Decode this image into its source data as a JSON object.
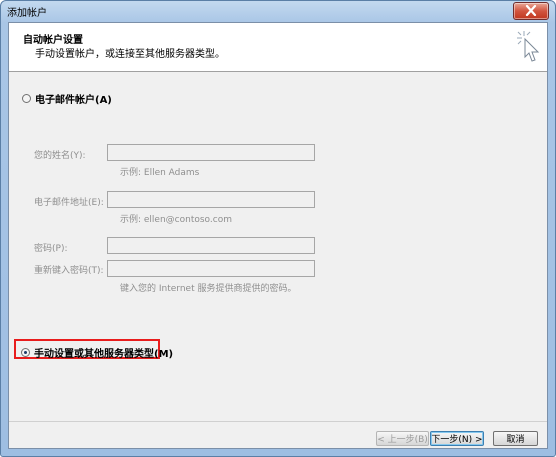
{
  "window": {
    "title": "添加帐户"
  },
  "header": {
    "title": "自动帐户设置",
    "subtitle": "手动设置帐户，或连接至其他服务器类型。"
  },
  "email_account": {
    "radio_label": "电子邮件帐户(A)",
    "checked": false,
    "name_label": "您的姓名(Y):",
    "name_hint": "示例: Ellen Adams",
    "email_label": "电子邮件地址(E):",
    "email_hint": "示例: ellen@contoso.com",
    "password_label": "密码(P):",
    "retype_label": "重新键入密码(T):",
    "password_hint": "键入您的 Internet 服务提供商提供的密码。"
  },
  "manual_setup": {
    "radio_label": "手动设置或其他服务器类型(M)",
    "checked": true
  },
  "buttons": {
    "back": "< 上一步(B)",
    "next": "下一步(N) >",
    "cancel": "取消"
  },
  "colors": {
    "highlight": "#e81c1c"
  }
}
